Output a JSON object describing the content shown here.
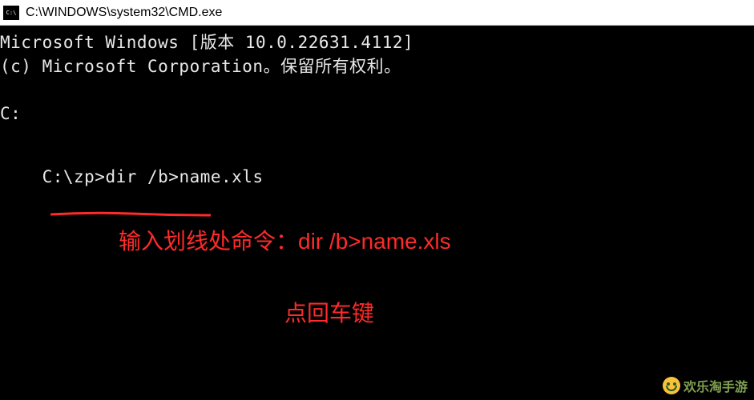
{
  "titlebar": {
    "title": "C:\\WINDOWS\\system32\\CMD.exe"
  },
  "terminal": {
    "banner_line1": "Microsoft Windows [版本 10.0.22631.4112]",
    "banner_line2": "(c) Microsoft Corporation。保留所有权利。",
    "prompt_blank": "C:",
    "prompt_cmd_prefix": "C:\\zp>",
    "command": "dir /b>name.xls"
  },
  "annotations": {
    "instruction1": "输入划线处命令：dir /b>name.xls",
    "instruction2": "点回车键"
  },
  "watermark": {
    "text": "欢乐淘手游"
  }
}
